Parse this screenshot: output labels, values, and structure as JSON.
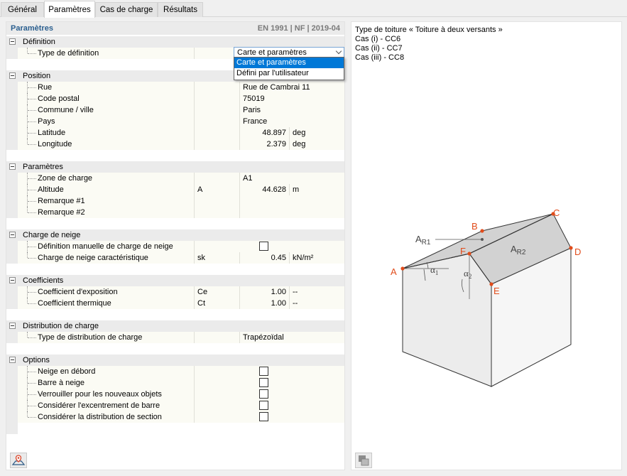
{
  "tabs": [
    {
      "label": "Général"
    },
    {
      "label": "Paramètres"
    },
    {
      "label": "Cas de charge"
    },
    {
      "label": "Résultats"
    }
  ],
  "panel": {
    "title": "Paramètres",
    "norm": "EN 1991 | NF | 2019-04"
  },
  "sections": {
    "definition": {
      "label": "Définition",
      "type_label": "Type de définition",
      "dropdown_value": "Carte et paramètres",
      "options": [
        "Carte et paramètres",
        "Défini par l'utilisateur"
      ]
    },
    "position": {
      "label": "Position",
      "rows": [
        {
          "name": "Rue",
          "value": "Rue de Cambrai 11",
          "unit": ""
        },
        {
          "name": "Code postal",
          "value": "75019",
          "unit": ""
        },
        {
          "name": "Commune / ville",
          "value": "Paris",
          "unit": ""
        },
        {
          "name": "Pays",
          "value": "France",
          "unit": ""
        },
        {
          "name": "Latitude",
          "value": "48.897",
          "unit": "deg"
        },
        {
          "name": "Longitude",
          "value": "2.379",
          "unit": "deg"
        }
      ]
    },
    "parametres": {
      "label": "Paramètres",
      "rows": [
        {
          "name": "Zone de charge",
          "symbol": "",
          "value": "A1",
          "unit": ""
        },
        {
          "name": "Altitude",
          "symbol": "A",
          "value": "44.628",
          "unit": "m"
        },
        {
          "name": "Remarque #1",
          "symbol": "",
          "value": "",
          "unit": ""
        },
        {
          "name": "Remarque #2",
          "symbol": "",
          "value": "",
          "unit": ""
        }
      ]
    },
    "charge_neige": {
      "label": "Charge de neige",
      "manual_label": "Définition manuelle de charge de neige",
      "manual_checked": false,
      "char_label": "Charge de neige caractéristique",
      "char_symbol": "sk",
      "char_value": "0.45",
      "char_unit": "kN/m²"
    },
    "coefficients": {
      "label": "Coefficients",
      "rows": [
        {
          "name": "Coefficient d'exposition",
          "symbol": "Ce",
          "value": "1.00",
          "unit": "--"
        },
        {
          "name": "Coefficient thermique",
          "symbol": "Ct",
          "value": "1.00",
          "unit": "--"
        }
      ]
    },
    "distribution": {
      "label": "Distribution de charge",
      "type_label": "Type de distribution de charge",
      "type_value": "Trapézoïdal"
    },
    "options": {
      "label": "Options",
      "rows": [
        {
          "name": "Neige en débord",
          "checked": false
        },
        {
          "name": "Barre à neige",
          "checked": false
        },
        {
          "name": "Verrouiller pour les nouveaux objets",
          "checked": false
        },
        {
          "name": "Considérer l'excentrement de barre",
          "checked": false
        },
        {
          "name": "Considérer la distribution de section",
          "checked": false
        }
      ]
    }
  },
  "info": {
    "line1": "Type de toiture « Toiture à deux versants »",
    "line2": "Cas (i) - CC6",
    "line3": "Cas (ii) - CC7",
    "line4": "Cas (iii) - CC8"
  },
  "diagram": {
    "points": {
      "A": "A",
      "B": "B",
      "C": "C",
      "D": "D",
      "E": "E",
      "F": "F"
    },
    "areas": {
      "AR1": "A",
      "AR1_sub": "R1",
      "AR2": "A",
      "AR2_sub": "R2"
    },
    "angles": {
      "a1": "α",
      "a1_sub": "1",
      "a2": "α",
      "a2_sub": "2"
    },
    "point_color": "#e14c1b"
  },
  "icons": {
    "map_button": "map-pin-icon",
    "image_button": "image-export-icon"
  }
}
